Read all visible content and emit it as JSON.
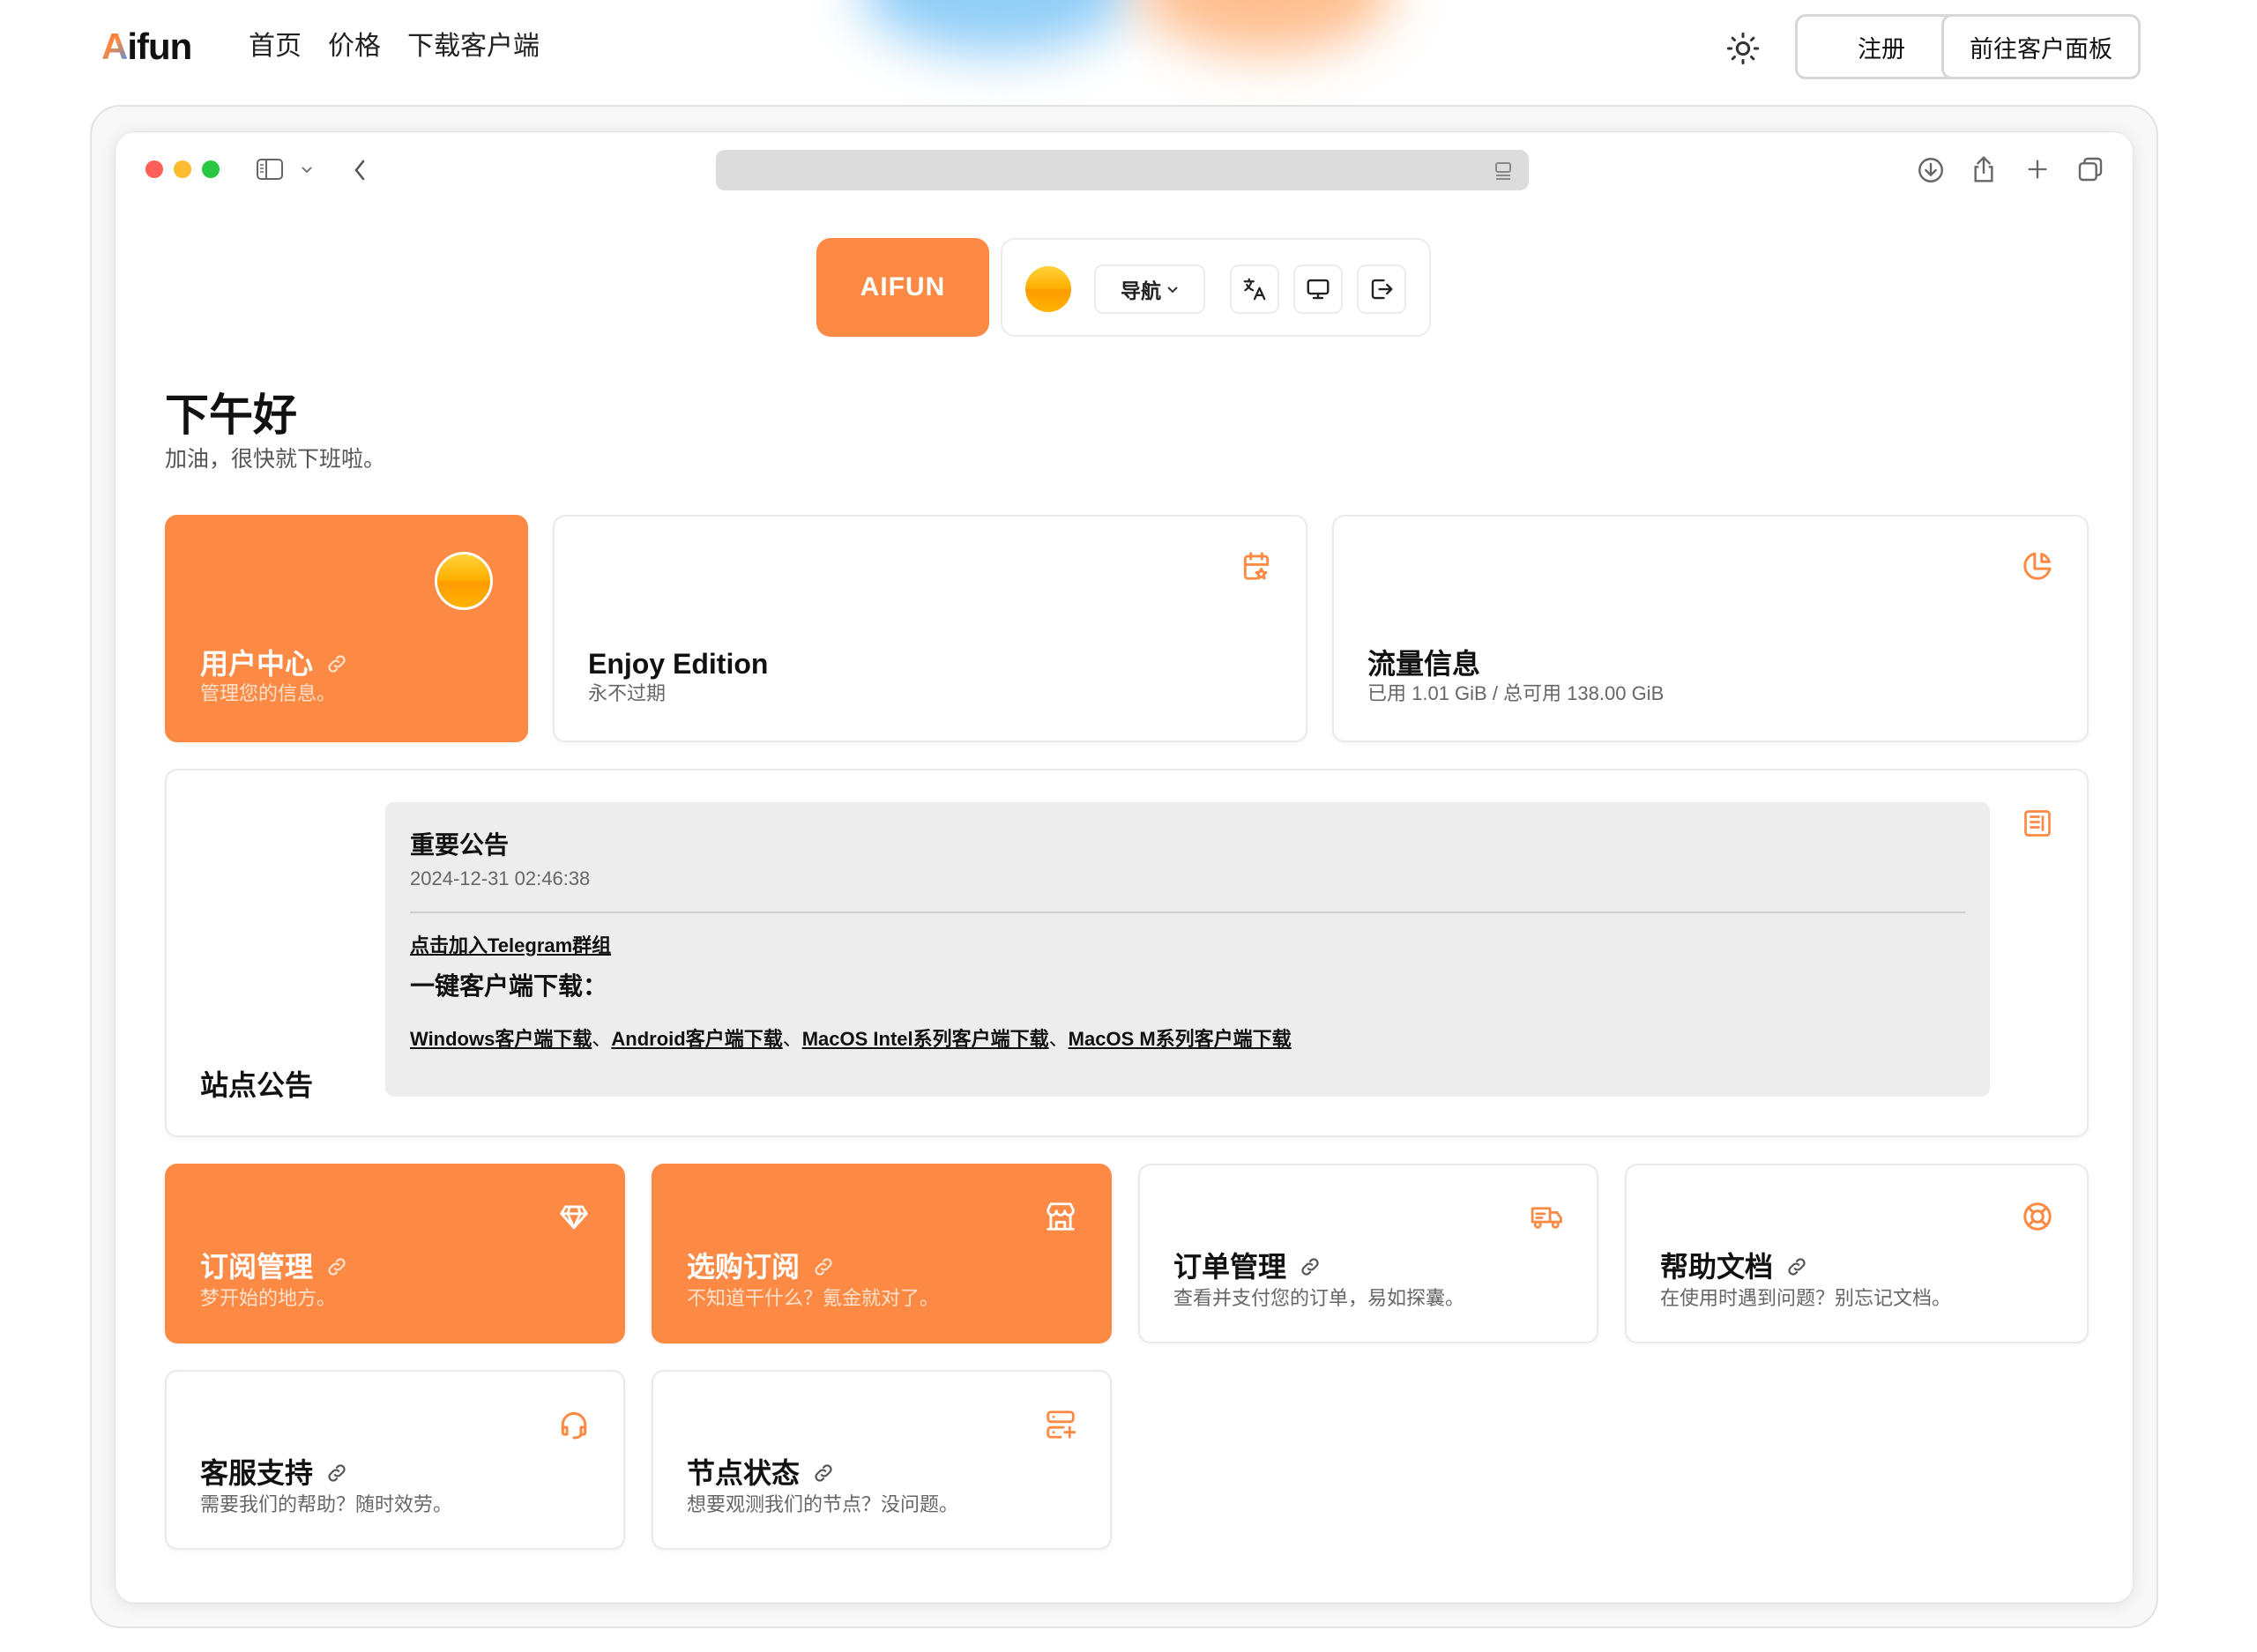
{
  "site_nav": {
    "brand": {
      "first": "A",
      "rest": "ifun"
    },
    "links": [
      "首页",
      "价格",
      "下载客户端"
    ],
    "register_label": "注册",
    "panel_label": "前往客户面板"
  },
  "header": {
    "logo_label": "AIFUN",
    "nav_dropdown_label": "导航"
  },
  "greeting": {
    "title": "下午好",
    "subtitle": "加油，很快就下班啦。"
  },
  "top_cards": {
    "user_center": {
      "title": "用户中心",
      "desc": "管理您的信息。"
    },
    "plan": {
      "title": "Enjoy Edition",
      "desc": "永不过期"
    },
    "traffic": {
      "title": "流量信息",
      "desc": "已用 1.01 GiB / 总可用 138.00 GiB"
    }
  },
  "announcement": {
    "label": "站点公告",
    "title": "重要公告",
    "date": "2024-12-31 02:46:38",
    "telegram_link": "点击加入Telegram群组",
    "download_heading": "一键客户端下载：",
    "downloads": [
      {
        "label": "Windows客户端下载",
        "sep": "、"
      },
      {
        "label": "Android客户端下载",
        "sep": "、"
      },
      {
        "label": "MacOS Intel系列客户端下载",
        "sep": "、"
      },
      {
        "label": "MacOS M系列客户端下载",
        "sep": ""
      }
    ]
  },
  "action_cards": [
    {
      "title": "订阅管理",
      "desc": "梦开始的地方。",
      "icon": "diamond-icon"
    },
    {
      "title": "选购订阅",
      "desc": "不知道干什么？氪金就对了。",
      "icon": "store-icon"
    },
    {
      "title": "订单管理",
      "desc": "查看并支付您的订单，易如探囊。",
      "icon": "truck-icon"
    },
    {
      "title": "帮助文档",
      "desc": "在使用时遇到问题？别忘记文档。",
      "icon": "lifebuoy-icon"
    },
    {
      "title": "客服支持",
      "desc": "需要我们的帮助？随时效劳。",
      "icon": "headset-icon"
    },
    {
      "title": "节点状态",
      "desc": "想要观测我们的节点？没问题。",
      "icon": "server-icon"
    }
  ],
  "colors": {
    "accent": "#fc8a44",
    "accent_light": "#ffe3cf"
  }
}
